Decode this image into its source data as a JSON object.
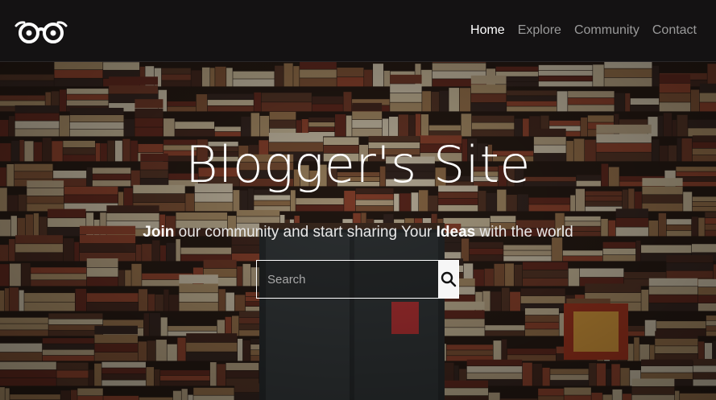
{
  "brand": {
    "logo_icon": "glasses-icon"
  },
  "nav": {
    "items": [
      {
        "label": "Home",
        "active": true
      },
      {
        "label": "Explore",
        "active": false
      },
      {
        "label": "Community",
        "active": false
      },
      {
        "label": "Contact",
        "active": false
      }
    ]
  },
  "hero": {
    "title": "Blogger's Site",
    "subtitle": {
      "word1": "Join",
      "text1": " our community and start sharing Your ",
      "word2": "Ideas",
      "text2": " with the world"
    },
    "background": "bookshelf-photo"
  },
  "search": {
    "placeholder": "Search",
    "button_icon": "search-icon"
  },
  "colors": {
    "nav_bg": "#141213",
    "nav_active": "#ffffff",
    "nav_inactive": "#9a9a9a",
    "search_button_bg": "#f6f6f6"
  }
}
